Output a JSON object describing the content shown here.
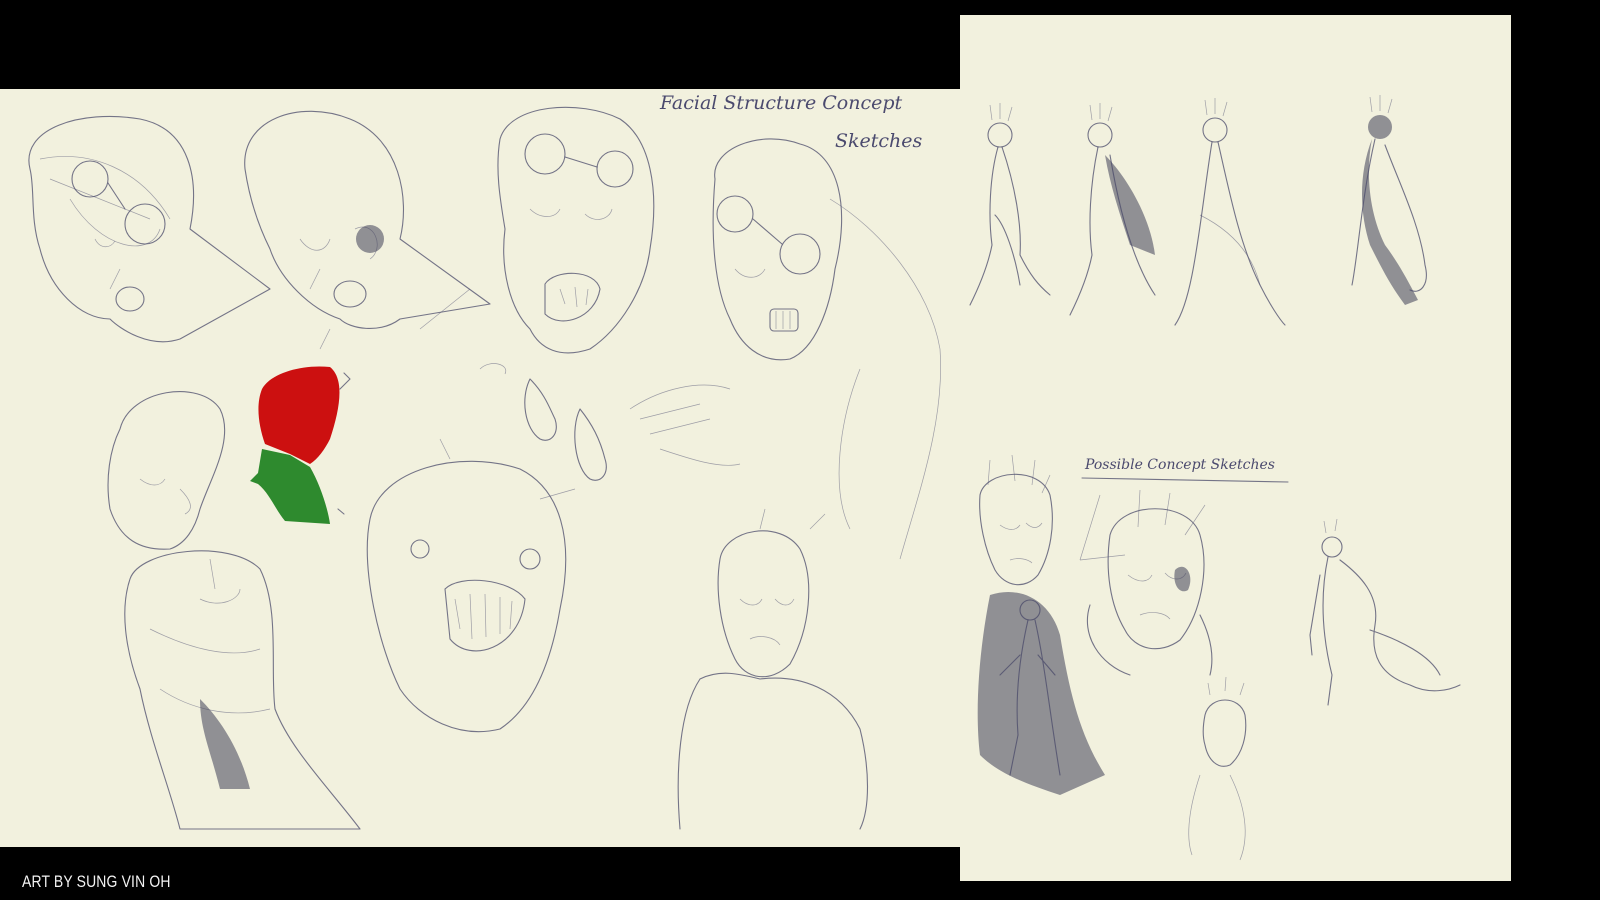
{
  "left_sheet": {
    "title_line1": "Facial Structure Concept",
    "title_line2": "Sketches"
  },
  "right_sheet": {
    "section_title": "Possible Concept Sketches"
  },
  "credit": "ART BY SUNG VIN OH",
  "colors": {
    "background": "#000000",
    "paper": "#f2f1de",
    "pencil": "#4a4a6a",
    "red_patch": "#cc1010",
    "green_patch": "#2e8a2e"
  }
}
